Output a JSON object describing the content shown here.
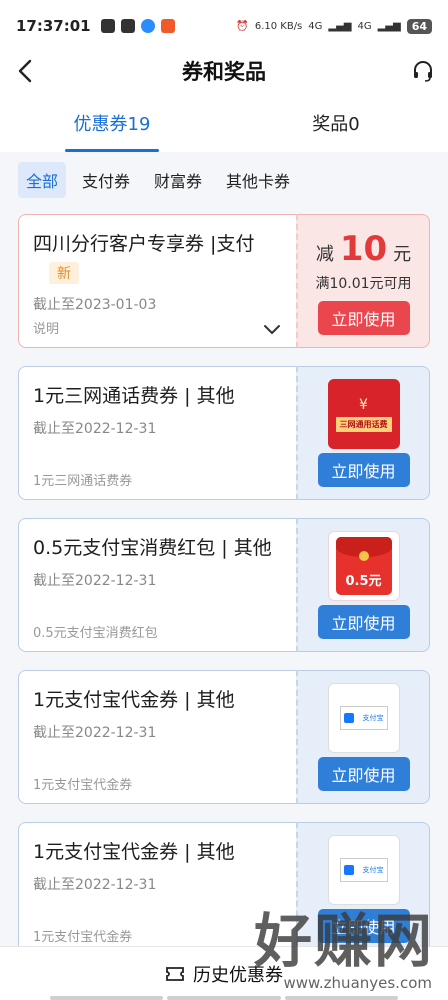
{
  "status_bar": {
    "time": "17:37:01",
    "net_speed": "6.10 KB/s",
    "sim1": "4G",
    "sim2": "4G",
    "battery": "64"
  },
  "header": {
    "title": "券和奖品"
  },
  "tabs": [
    {
      "label": "优惠券19",
      "active": true
    },
    {
      "label": "奖品0",
      "active": false
    }
  ],
  "filters": [
    {
      "label": "全部",
      "active": true
    },
    {
      "label": "支付券",
      "active": false
    },
    {
      "label": "财富券",
      "active": false
    },
    {
      "label": "其他卡券",
      "active": false
    }
  ],
  "coupons": [
    {
      "title": "四川分行客户专享券 |支付",
      "tag": "新",
      "date": "截止至2023-01-03",
      "note": "说明",
      "amount_prefix": "减",
      "amount": "10",
      "amount_unit": "元",
      "condition": "满10.01元可用",
      "button": "立即使用"
    },
    {
      "title": "1元三网通话费券 | 其他",
      "date": "截止至2022-12-31",
      "note": "1元三网通话费券",
      "image_text": "三网通用话费",
      "button": "立即使用"
    },
    {
      "title": "0.5元支付宝消费红包 | 其他",
      "date": "截止至2022-12-31",
      "note": "0.5元支付宝消费红包",
      "image_text": "0.5元",
      "button": "立即使用"
    },
    {
      "title": "1元支付宝代金券 | 其他",
      "date": "截止至2022-12-31",
      "note": "1元支付宝代金券",
      "image_text": "支付宝",
      "button": "立即使用"
    },
    {
      "title": "1元支付宝代金券 | 其他",
      "date": "截止至2022-12-31",
      "note": "1元支付宝代金券",
      "image_text": "支付宝",
      "button": "立即使用"
    }
  ],
  "bottom_bar": {
    "label": "历史优惠券"
  },
  "watermark": {
    "text": "好赚网",
    "url": "www.zhuanyes.com"
  },
  "colors": {
    "accent": "#1a6ed8",
    "danger": "#e9474d",
    "button_blue": "#2f7fd9"
  }
}
